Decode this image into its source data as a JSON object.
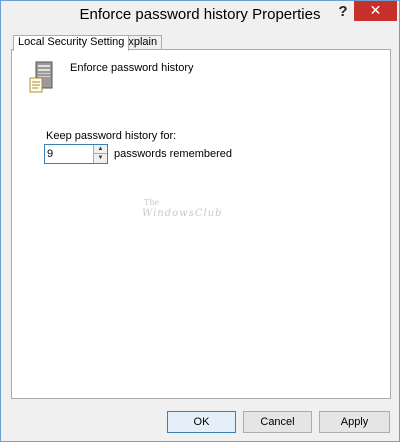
{
  "window": {
    "title": "Enforce password history Properties",
    "help_glyph": "?",
    "close_glyph": "✕"
  },
  "tabs": [
    {
      "label": "Local Security Setting",
      "active": true
    },
    {
      "label": "Explain",
      "active": false
    }
  ],
  "panel": {
    "icon": "server-icon",
    "policy_name": "Enforce password history",
    "keep_label": "Keep password history for:",
    "history_value": "9",
    "unit_label": "passwords remembered",
    "watermark_top": "The",
    "watermark_main": "WindowsClub"
  },
  "buttons": {
    "ok": "OK",
    "cancel": "Cancel",
    "apply": "Apply"
  },
  "colors": {
    "close": "#c7312a",
    "focus_border": "#3c7fb1",
    "window_border": "#6d9fd2"
  }
}
